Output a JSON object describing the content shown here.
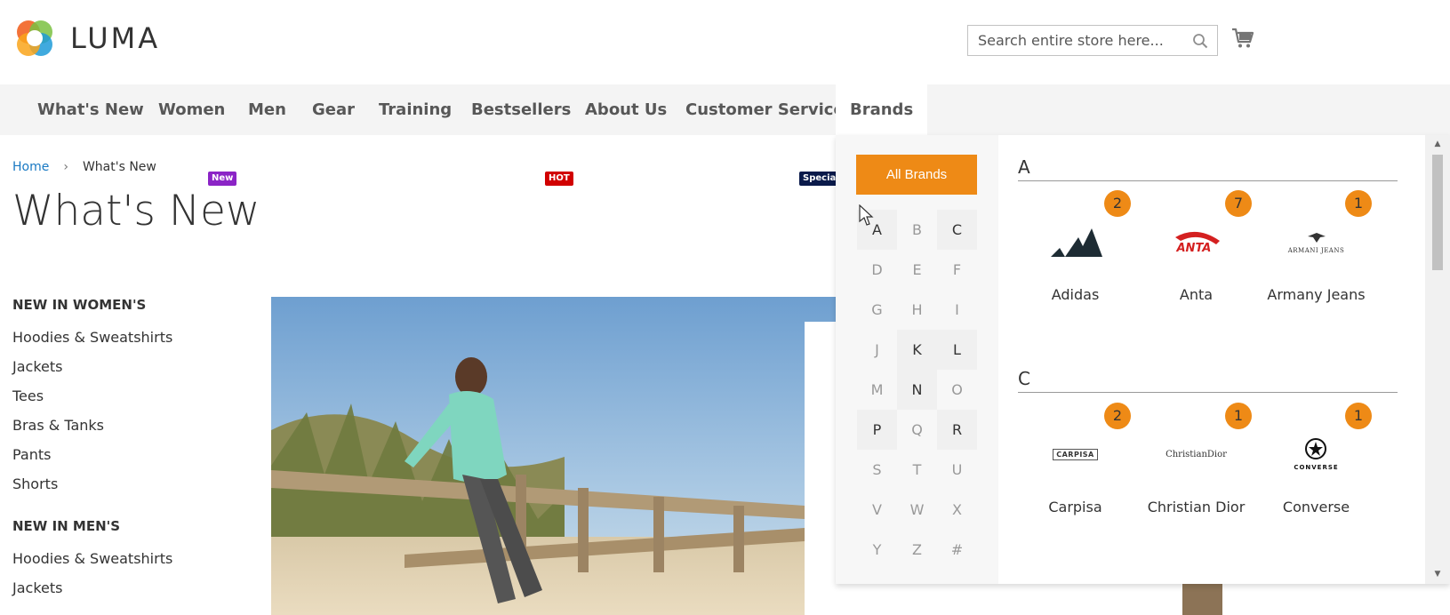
{
  "header": {
    "logo_text": "LUMA",
    "search_placeholder": "Search entire store here...",
    "icons": [
      "luma-logo-icon",
      "search-icon",
      "cart-icon"
    ]
  },
  "nav": {
    "items": [
      {
        "label": "What's New"
      },
      {
        "label": "Women",
        "badge": "New"
      },
      {
        "label": "Men"
      },
      {
        "label": "Gear"
      },
      {
        "label": "Training"
      },
      {
        "label": "Bestsellers",
        "badge": "HOT"
      },
      {
        "label": "About Us"
      },
      {
        "label": "Customer Service",
        "badge": "Special"
      },
      {
        "label": "Brands",
        "active": true
      }
    ]
  },
  "breadcrumb": {
    "home": "Home",
    "separator": "›",
    "current": "What's New"
  },
  "page": {
    "title": "What's New"
  },
  "sidebar": {
    "groups": [
      {
        "title": "NEW IN WOMEN'S",
        "items": [
          "Hoodies & Sweatshirts",
          "Jackets",
          "Tees",
          "Bras & Tanks",
          "Pants",
          "Shorts"
        ]
      },
      {
        "title": "NEW IN MEN'S",
        "items": [
          "Hoodies & Sweatshirts",
          "Jackets"
        ]
      }
    ]
  },
  "brands_menu": {
    "all_brands_label": "All Brands",
    "letters": [
      "A",
      "B",
      "C",
      "D",
      "E",
      "F",
      "G",
      "H",
      "I",
      "J",
      "K",
      "L",
      "M",
      "N",
      "O",
      "P",
      "Q",
      "R",
      "S",
      "T",
      "U",
      "V",
      "W",
      "X",
      "Y",
      "Z",
      "#"
    ],
    "active_letters": [
      "A",
      "C",
      "K",
      "L",
      "N",
      "P",
      "R"
    ],
    "sections": [
      {
        "letter": "A",
        "brands": [
          {
            "name": "Adidas",
            "count": "2",
            "logo_text": ""
          },
          {
            "name": "Anta",
            "count": "7",
            "logo_text": "ANTA"
          },
          {
            "name": "Armany Jeans",
            "count": "1",
            "logo_text": "ARMANI JEANS"
          }
        ]
      },
      {
        "letter": "C",
        "brands": [
          {
            "name": "Carpisa",
            "count": "2",
            "logo_text": "CARPISA"
          },
          {
            "name": "Christian Dior",
            "count": "1",
            "logo_text": "ChristianDior"
          },
          {
            "name": "Converse",
            "count": "1",
            "logo_text": "CONVERSE"
          }
        ]
      }
    ]
  },
  "colors": {
    "accent_orange": "#ee8a16",
    "link_blue": "#1979c3",
    "badge_new": "#8b24c6",
    "badge_hot": "#d10000",
    "badge_special": "#0a1a4a"
  }
}
